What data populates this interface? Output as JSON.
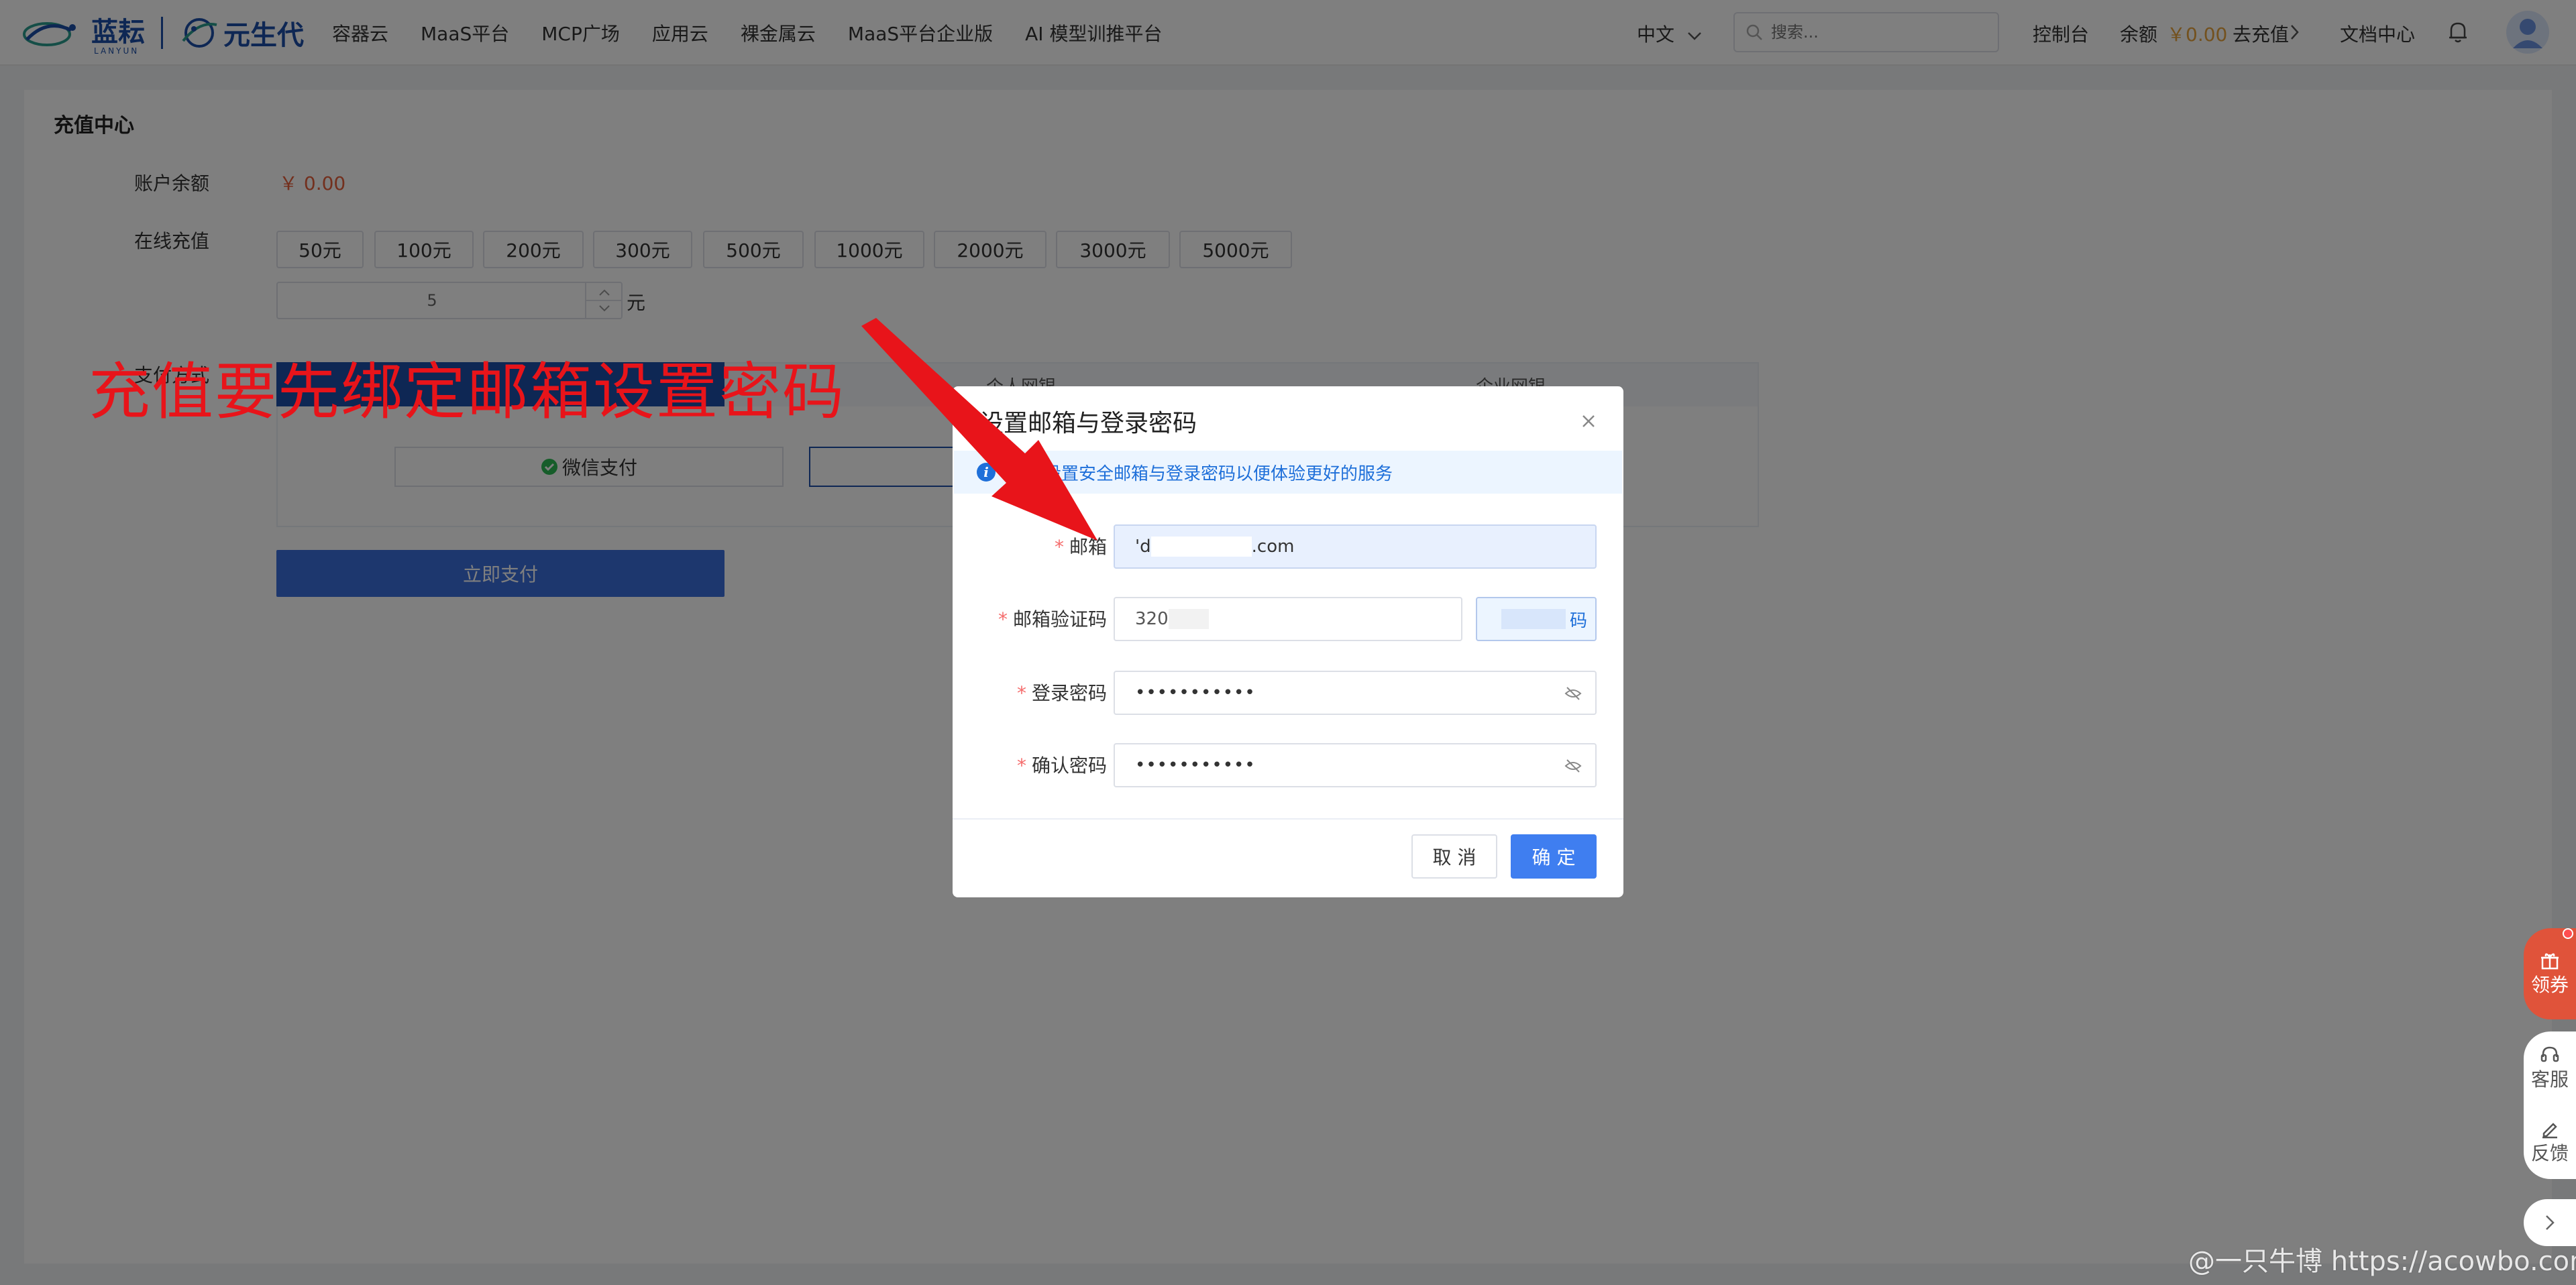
{
  "header": {
    "logo_lanyun": "蓝耘",
    "logo_lanyun_sub": "LANYUN",
    "logo_yuanshengdai": "元生代",
    "nav": [
      "容器云",
      "MaaS平台",
      "MCP广场",
      "应用云",
      "裸金属云",
      "MaaS平台企业版",
      "AI 模型训推平台"
    ],
    "language": "中文",
    "search_placeholder": "搜索...",
    "console": "控制台",
    "balance_label": "余额",
    "balance_value": "￥0.00",
    "recharge_link": "去充值",
    "docs": "文档中心"
  },
  "page": {
    "title": "充值中心",
    "balance_label": "账户余额",
    "balance_value": "￥ 0.00",
    "online_label": "在线充值",
    "amounts": [
      "50元",
      "100元",
      "200元",
      "300元",
      "500元",
      "1000元",
      "2000元",
      "3000元",
      "5000元"
    ],
    "custom_amount": "5",
    "unit": "元",
    "pay_method_label": "支付方式",
    "tab_personal": "个人网银",
    "tab_enterprise": "企业网银",
    "wechat_pay": "微信支付",
    "pay_now": "立即支付"
  },
  "annotation": {
    "text": "充值要先绑定邮箱设置密码",
    "color": "#e8141a"
  },
  "dialog": {
    "title": "设置邮箱与登录密码",
    "tip": "建议设置安全邮箱与登录密码以便体验更好的服务",
    "email_label": "邮箱",
    "email_prefix": "'d",
    "email_suffix": ".com",
    "code_label": "邮箱验证码",
    "code_value": "320",
    "code_button": "码",
    "password_label": "登录密码",
    "password_value": "•••••••••••",
    "confirm_label": "确认密码",
    "confirm_value": "•••••••••••",
    "cancel": "取 消",
    "ok": "确 定"
  },
  "float_tools": {
    "coupon": "领券",
    "service": "客服",
    "feedback": "反馈"
  },
  "watermark": "@一只牛博 https://acowbo.com",
  "colors": {
    "brand": "#1d4fa8",
    "primary_button": "#3f7ef0",
    "price": "#e6a23c",
    "required": "#f56c6c"
  }
}
